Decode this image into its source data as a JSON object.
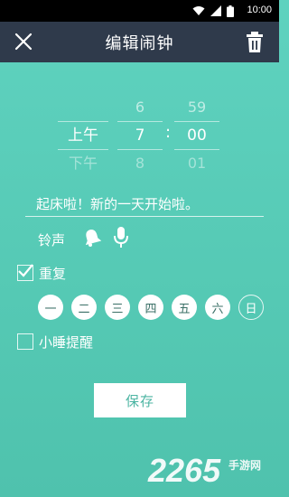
{
  "status_bar": {
    "time": "10:00"
  },
  "header": {
    "title": "编辑闹钟"
  },
  "picker": {
    "ampm": {
      "above": "",
      "selected": "上午",
      "below": "下午"
    },
    "hour": {
      "above": "6",
      "selected": "7",
      "below": "8"
    },
    "minute": {
      "above": "59",
      "selected": "00",
      "below": "01"
    },
    "separator": ":"
  },
  "label_text": "起床啦！新的一天开始啦。",
  "ringtone": {
    "label": "铃声"
  },
  "repeat": {
    "label": "重复",
    "checked": true,
    "days": [
      {
        "label": "一",
        "selected": true
      },
      {
        "label": "二",
        "selected": true
      },
      {
        "label": "三",
        "selected": true
      },
      {
        "label": "四",
        "selected": true
      },
      {
        "label": "五",
        "selected": true
      },
      {
        "label": "六",
        "selected": true
      },
      {
        "label": "日",
        "selected": false
      }
    ]
  },
  "snooze": {
    "label": "小睡提醒",
    "checked": false
  },
  "save_label": "保存",
  "watermark": {
    "main": "2265",
    "sub": "手游网"
  }
}
